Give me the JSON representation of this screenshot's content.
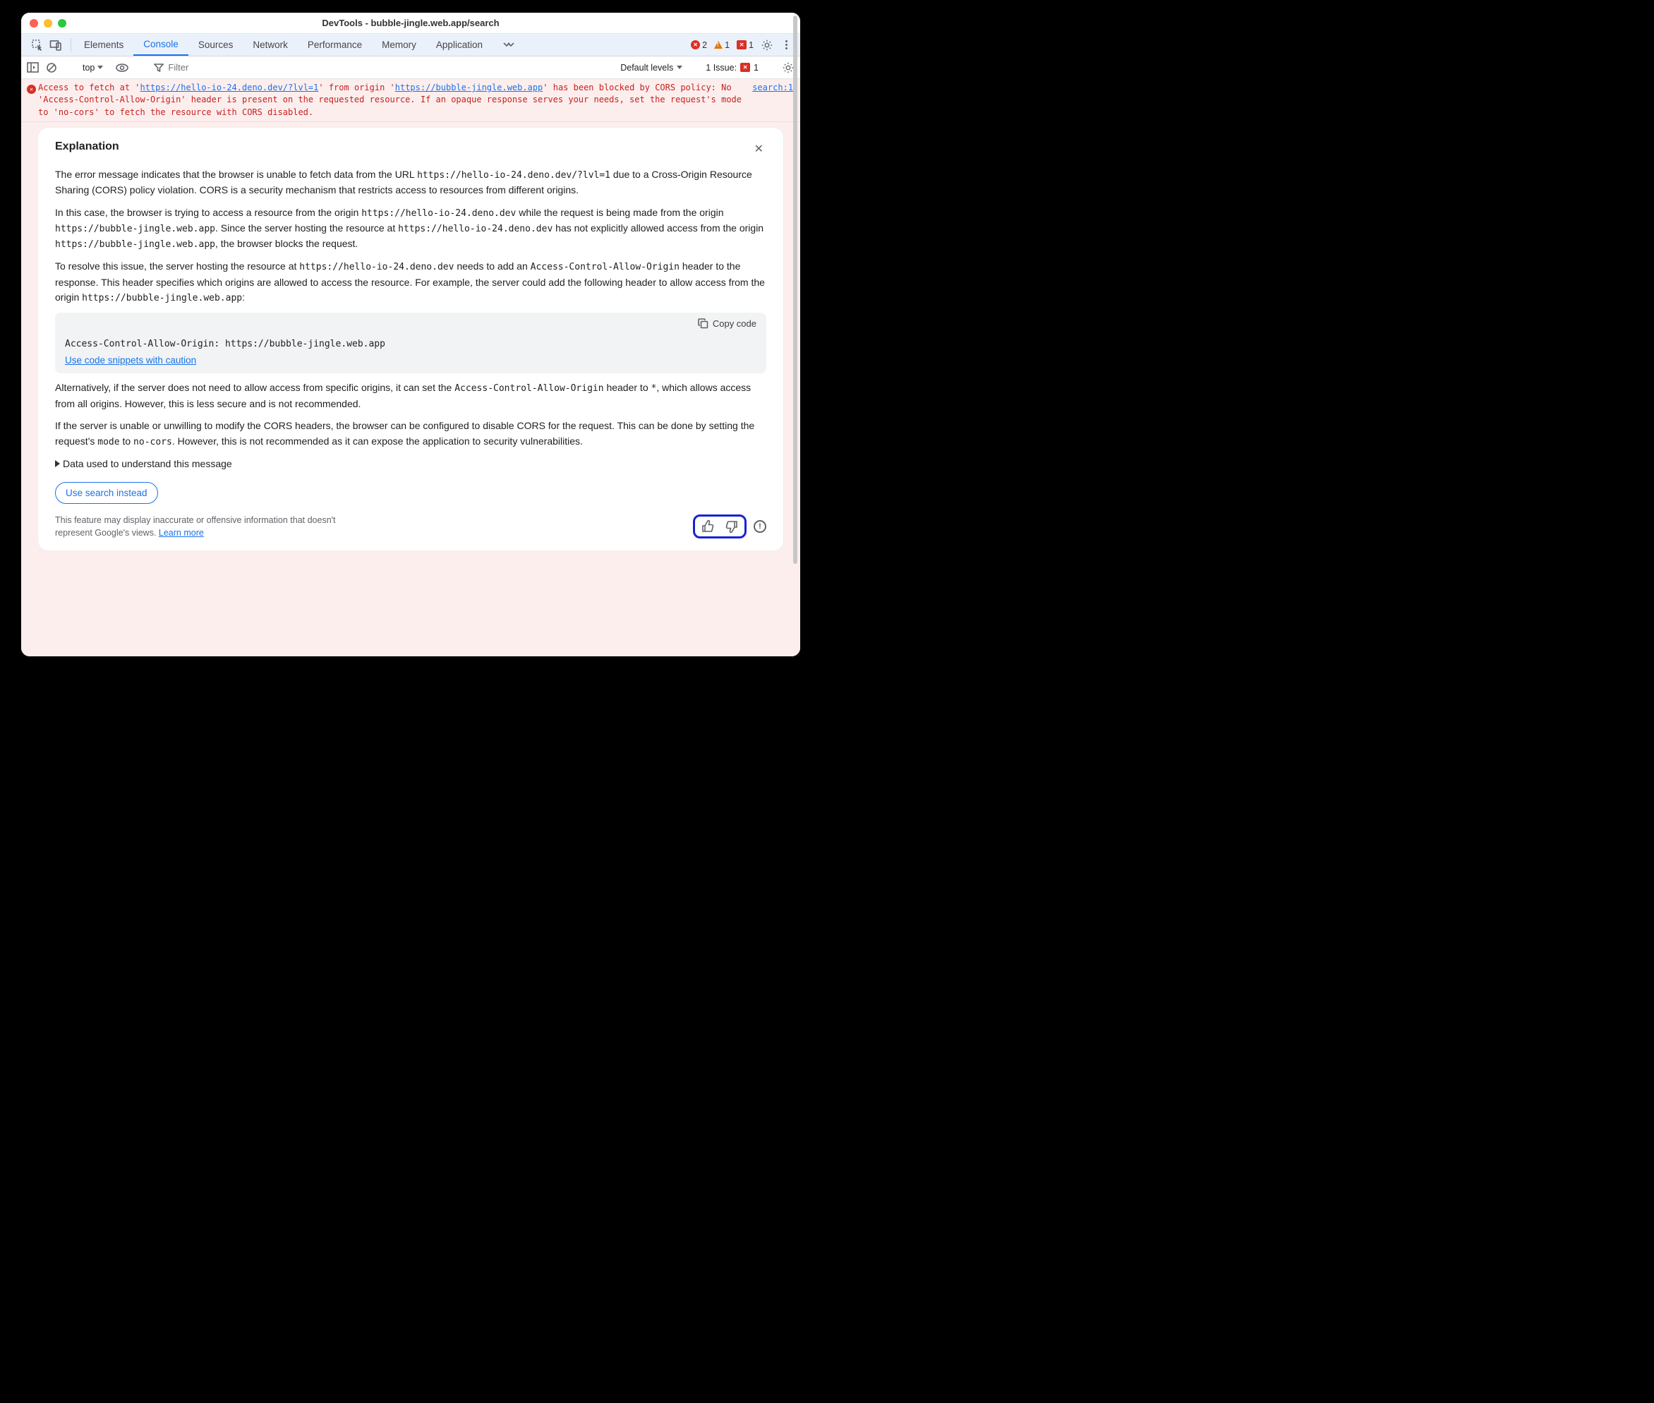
{
  "window": {
    "title": "DevTools - bubble-jingle.web.app/search"
  },
  "tabs": {
    "items": [
      "Elements",
      "Console",
      "Sources",
      "Network",
      "Performance",
      "Memory",
      "Application"
    ],
    "active_index": 1
  },
  "counters": {
    "errors": "2",
    "warnings": "1",
    "badge": "1"
  },
  "subbar": {
    "context": "top",
    "filter_placeholder": "Filter",
    "default_levels": "Default levels",
    "issues_label": "1 Issue:",
    "issues_count": "1"
  },
  "error": {
    "text_prefix": "Access to fetch at '",
    "link1": "https://hello-io-24.deno.dev/?lvl=1",
    "text_mid": "' from origin '",
    "link2": "https://bubble-jingle.web.app",
    "text_suffix": "' has been blocked by CORS policy: No 'Access-Control-Allow-Origin' header is present on the requested resource. If an opaque response serves your needs, set the request's mode to 'no-cors' to fetch the resource with CORS disabled.",
    "source": "search:1"
  },
  "explanation": {
    "title": "Explanation",
    "p1a": "The error message indicates that the browser is unable to fetch data from the URL ",
    "p1_code": "https://hello-io-24.deno.dev/?lvl=1",
    "p1b": " due to a Cross-Origin Resource Sharing (CORS) policy violation. CORS is a security mechanism that restricts access to resources from different origins.",
    "p2a": "In this case, the browser is trying to access a resource from the origin ",
    "p2_code1": "https://hello-io-24.deno.dev",
    "p2b": " while the request is being made from the origin ",
    "p2_code2": "https://bubble-jingle.web.app",
    "p2c": ". Since the server hosting the resource at ",
    "p2_code3": "https://hello-io-24.deno.dev",
    "p2d": " has not explicitly allowed access from the origin ",
    "p2_code4": "https://bubble-jingle.web.app",
    "p2e": ", the browser blocks the request.",
    "p3a": "To resolve this issue, the server hosting the resource at ",
    "p3_code1": "https://hello-io-24.deno.dev",
    "p3b": " needs to add an ",
    "p3_code2": "Access-Control-Allow-Origin",
    "p3c": " header to the response. This header specifies which origins are allowed to access the resource. For example, the server could add the following header to allow access from the origin ",
    "p3_code3": "https://bubble-jingle.web.app",
    "p3d": ":",
    "copy_label": "Copy code",
    "code": "Access-Control-Allow-Origin: https://bubble-jingle.web.app",
    "caution_link": "Use code snippets with caution",
    "p4a": "Alternatively, if the server does not need to allow access from specific origins, it can set the ",
    "p4_code1": "Access-Control-Allow-Origin",
    "p4b": " header to ",
    "p4_code2": "*",
    "p4c": ", which allows access from all origins. However, this is less secure and is not recommended.",
    "p5a": "If the server is unable or unwilling to modify the CORS headers, the browser can be configured to disable CORS for the request. This can be done by setting the request's ",
    "p5_code1": "mode",
    "p5b": " to ",
    "p5_code2": "no-cors",
    "p5c": ". However, this is not recommended as it can expose the application to security vulnerabilities.",
    "details": "Data used to understand this message",
    "search_btn": "Use search instead",
    "disclaimer": "This feature may display inaccurate or offensive information that doesn't represent Google's views. ",
    "learn_more": "Learn more"
  }
}
